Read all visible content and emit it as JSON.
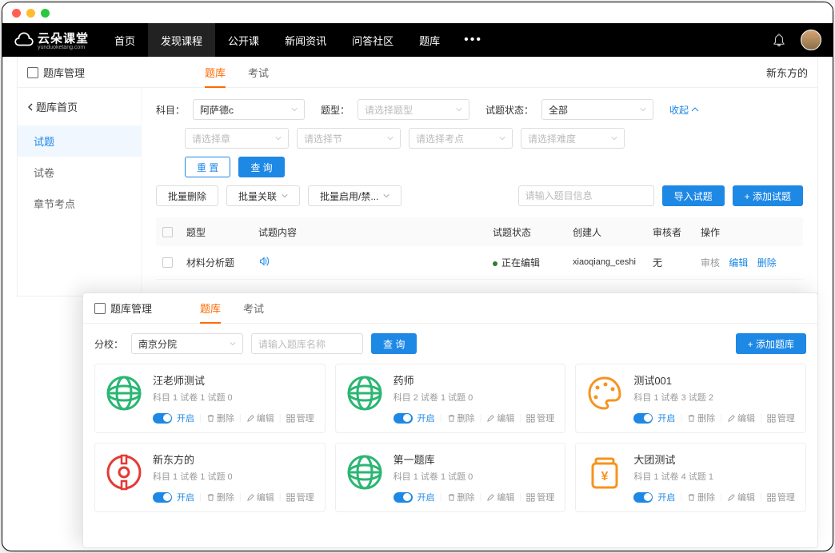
{
  "logo": {
    "text": "云朵课堂",
    "sub": "yunduoketang.com"
  },
  "nav": {
    "items": [
      "首页",
      "发现课程",
      "公开课",
      "新闻资讯",
      "问答社区",
      "题库"
    ],
    "active_index": 1
  },
  "win1": {
    "breadcrumb": "题库管理",
    "tabs": [
      "题库",
      "考试"
    ],
    "header_right": "新东方的",
    "sidebar": {
      "back": "题库首页",
      "items": [
        "试题",
        "试卷",
        "章节考点"
      ],
      "active_index": 0
    },
    "filters": {
      "subject_label": "科目：",
      "subject_value": "阿萨德c",
      "type_label": "题型：",
      "type_placeholder": "请选择题型",
      "status_label": "试题状态：",
      "status_value": "全部",
      "collapse": "收起",
      "chapter_placeholder": "请选择章",
      "section_placeholder": "请选择节",
      "point_placeholder": "请选择考点",
      "difficulty_placeholder": "请选择难度",
      "reset": "重 置",
      "query": "查 询"
    },
    "toolbar": {
      "bulk_delete": "批量删除",
      "bulk_link": "批量关联",
      "bulk_toggle": "批量启用/禁...",
      "search_placeholder": "请输入题目信息",
      "import": "导入试题",
      "add": "+ 添加试题"
    },
    "table": {
      "headers": {
        "type": "题型",
        "content": "试题内容",
        "status": "试题状态",
        "creator": "创建人",
        "reviewer": "审核者",
        "ops": "操作"
      },
      "row": {
        "type": "材料分析题",
        "status": "正在编辑",
        "creator": "xiaoqiang_ceshi",
        "reviewer": "无",
        "op_review": "审核",
        "op_edit": "编辑",
        "op_delete": "删除"
      }
    }
  },
  "win2": {
    "breadcrumb": "题库管理",
    "tabs": [
      "题库",
      "考试"
    ],
    "branch_label": "分校：",
    "branch_value": "南京分院",
    "name_placeholder": "请输入题库名称",
    "query": "查 询",
    "add": "+ 添加题库",
    "ops": {
      "on": "开启",
      "delete": "删除",
      "edit": "编辑",
      "manage": "管理"
    },
    "cards": [
      {
        "title": "汪老师测试",
        "meta": "科目 1  试卷 1  试题 0",
        "icon": "globe-green"
      },
      {
        "title": "药师",
        "meta": "科目 2  试卷 1  试题 0",
        "icon": "globe-green"
      },
      {
        "title": "测试001",
        "meta": "科目 1  试卷 3  试题 2",
        "icon": "palette-orange"
      },
      {
        "title": "新东方的",
        "meta": "科目 1  试卷 1  试题 0",
        "icon": "coin-red"
      },
      {
        "title": "第一题库",
        "meta": "科目 1  试卷 1  试题 0",
        "icon": "globe-green"
      },
      {
        "title": "大团测试",
        "meta": "科目 1  试卷 4  试题 1",
        "icon": "jar-orange"
      }
    ]
  }
}
